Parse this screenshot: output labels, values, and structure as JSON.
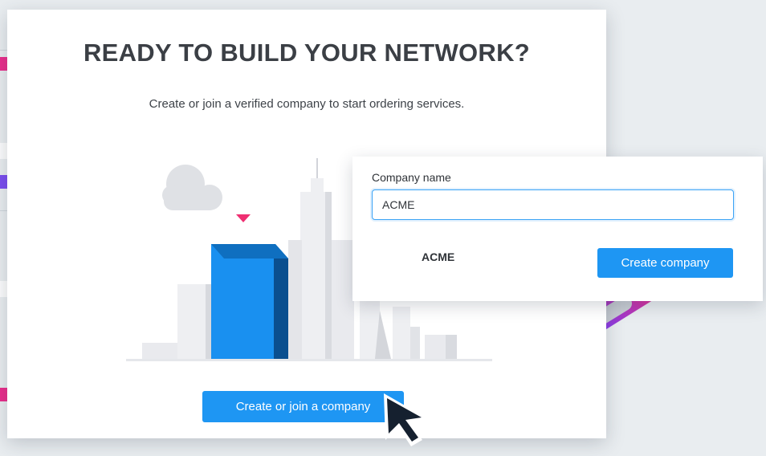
{
  "header": {
    "title": "READY TO BUILD YOUR NETWORK?",
    "subtitle": "Create or join a verified company to start ordering services."
  },
  "main": {
    "cta_label": "Create or join a company"
  },
  "company_form": {
    "field_label": "Company name",
    "input_value": "ACME",
    "suggestion": "ACME",
    "create_label": "Create company"
  },
  "colors": {
    "accent_blue": "#1e96f3",
    "accent_pink": "#ea2e8c",
    "accent_purple": "#7b4ef0",
    "highlight_building": "#1990f0"
  },
  "icons": {
    "cursor": "mouse-pointer-icon",
    "marker": "location-marker-icon",
    "cloud": "cloud-icon"
  }
}
